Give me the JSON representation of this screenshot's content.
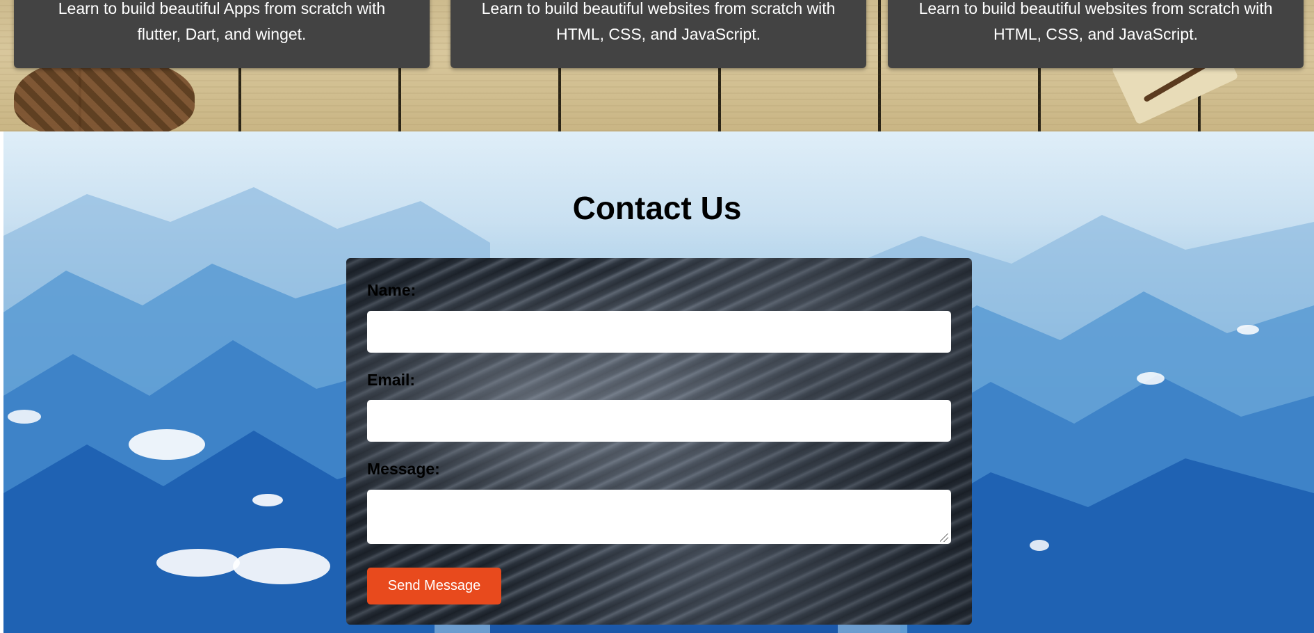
{
  "courses": [
    {
      "line1": "Learn to build beautiful Apps from scratch with",
      "line2": "flutter, Dart, and winget."
    },
    {
      "line1": "Learn to build beautiful websites from scratch with",
      "line2": "HTML, CSS, and JavaScript."
    },
    {
      "line1": "Learn to build beautiful websites from scratch with",
      "line2": "HTML, CSS, and JavaScript."
    }
  ],
  "contact": {
    "title": "Contact Us",
    "name_label": "Name:",
    "name_value": "",
    "email_label": "Email:",
    "email_value": "",
    "message_label": "Message:",
    "message_value": "",
    "send_label": "Send Message"
  },
  "colors": {
    "card_bg": "#434343",
    "send_button": "#e84a1d"
  }
}
